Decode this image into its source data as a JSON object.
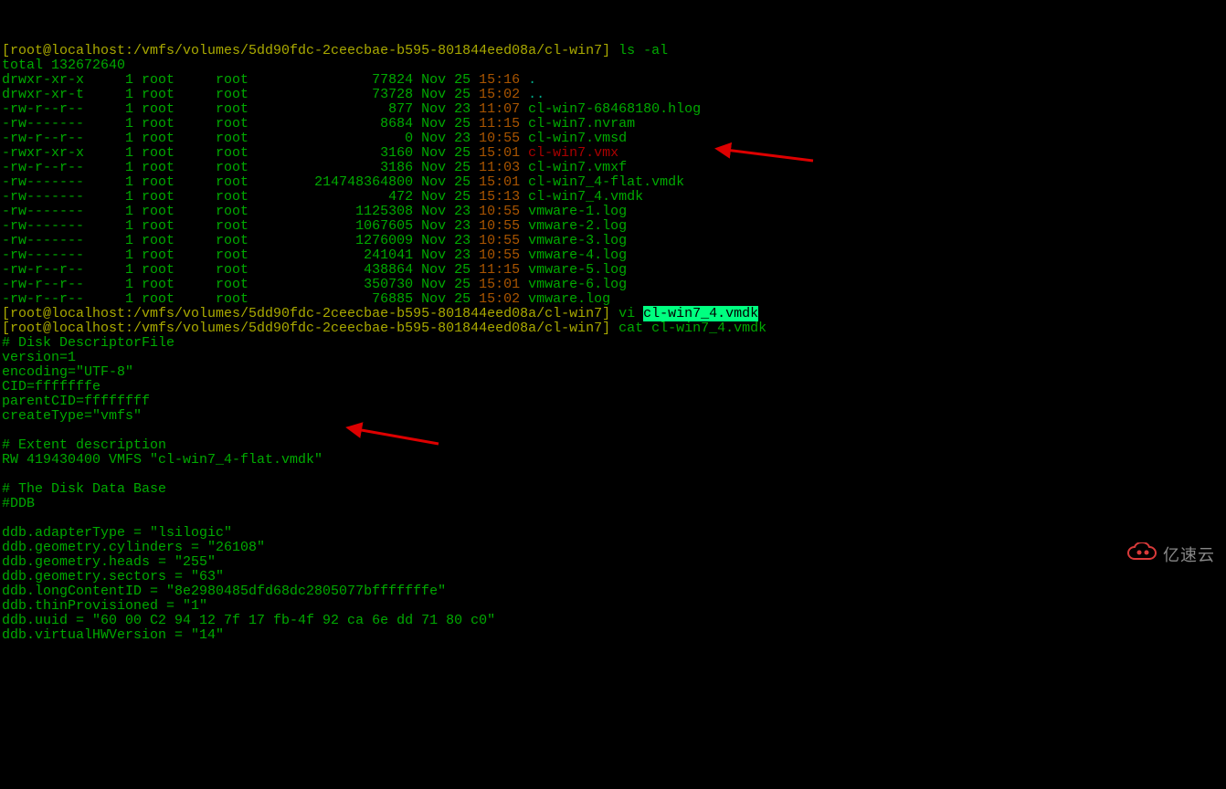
{
  "prompt_path": "[root@localhost:/vmfs/volumes/5dd90fdc-2ceecbae-b595-801844eed08a/cl-win7]",
  "cmd_ls": "ls -al",
  "total_line": "total 132672640",
  "listing": [
    {
      "perm": "drwxr-xr-x",
      "links": "1",
      "owner": "root",
      "group": "root",
      "size": "77824",
      "month": "Nov",
      "day": "25",
      "time": "15:16",
      "name": ".",
      "name_class": "cyan"
    },
    {
      "perm": "drwxr-xr-t",
      "links": "1",
      "owner": "root",
      "group": "root",
      "size": "73728",
      "month": "Nov",
      "day": "25",
      "time": "15:02",
      "name": "..",
      "name_class": "cyan"
    },
    {
      "perm": "-rw-r--r--",
      "links": "1",
      "owner": "root",
      "group": "root",
      "size": "877",
      "month": "Nov",
      "day": "23",
      "time": "11:07",
      "name": "cl-win7-68468180.hlog",
      "name_class": "green"
    },
    {
      "perm": "-rw-------",
      "links": "1",
      "owner": "root",
      "group": "root",
      "size": "8684",
      "month": "Nov",
      "day": "25",
      "time": "11:15",
      "name": "cl-win7.nvram",
      "name_class": "green"
    },
    {
      "perm": "-rw-r--r--",
      "links": "1",
      "owner": "root",
      "group": "root",
      "size": "0",
      "month": "Nov",
      "day": "23",
      "time": "10:55",
      "name": "cl-win7.vmsd",
      "name_class": "green"
    },
    {
      "perm": "-rwxr-xr-x",
      "links": "1",
      "owner": "root",
      "group": "root",
      "size": "3160",
      "month": "Nov",
      "day": "25",
      "time": "15:01",
      "name": "cl-win7.vmx",
      "name_class": "red"
    },
    {
      "perm": "-rw-r--r--",
      "links": "1",
      "owner": "root",
      "group": "root",
      "size": "3186",
      "month": "Nov",
      "day": "25",
      "time": "11:03",
      "name": "cl-win7.vmxf",
      "name_class": "green"
    },
    {
      "perm": "-rw-------",
      "links": "1",
      "owner": "root",
      "group": "root",
      "size": "214748364800",
      "month": "Nov",
      "day": "25",
      "time": "15:01",
      "name": "cl-win7_4-flat.vmdk",
      "name_class": "green"
    },
    {
      "perm": "-rw-------",
      "links": "1",
      "owner": "root",
      "group": "root",
      "size": "472",
      "month": "Nov",
      "day": "25",
      "time": "15:13",
      "name": "cl-win7_4.vmdk",
      "name_class": "green"
    },
    {
      "perm": "-rw-------",
      "links": "1",
      "owner": "root",
      "group": "root",
      "size": "1125308",
      "month": "Nov",
      "day": "23",
      "time": "10:55",
      "name": "vmware-1.log",
      "name_class": "green"
    },
    {
      "perm": "-rw-------",
      "links": "1",
      "owner": "root",
      "group": "root",
      "size": "1067605",
      "month": "Nov",
      "day": "23",
      "time": "10:55",
      "name": "vmware-2.log",
      "name_class": "green"
    },
    {
      "perm": "-rw-------",
      "links": "1",
      "owner": "root",
      "group": "root",
      "size": "1276009",
      "month": "Nov",
      "day": "23",
      "time": "10:55",
      "name": "vmware-3.log",
      "name_class": "green"
    },
    {
      "perm": "-rw-------",
      "links": "1",
      "owner": "root",
      "group": "root",
      "size": "241041",
      "month": "Nov",
      "day": "23",
      "time": "10:55",
      "name": "vmware-4.log",
      "name_class": "green"
    },
    {
      "perm": "-rw-r--r--",
      "links": "1",
      "owner": "root",
      "group": "root",
      "size": "438864",
      "month": "Nov",
      "day": "25",
      "time": "11:15",
      "name": "vmware-5.log",
      "name_class": "green"
    },
    {
      "perm": "-rw-r--r--",
      "links": "1",
      "owner": "root",
      "group": "root",
      "size": "350730",
      "month": "Nov",
      "day": "25",
      "time": "15:01",
      "name": "vmware-6.log",
      "name_class": "green"
    },
    {
      "perm": "-rw-r--r--",
      "links": "1",
      "owner": "root",
      "group": "root",
      "size": "76885",
      "month": "Nov",
      "day": "25",
      "time": "15:02",
      "name": "vmware.log",
      "name_class": "green"
    }
  ],
  "cmd_vi": "vi ",
  "vi_arg": "cl-win7_4.vmdk",
  "cmd_cat": "cat cl-win7_4.vmdk",
  "descriptor": [
    "# Disk DescriptorFile",
    "version=1",
    "encoding=\"UTF-8\"",
    "CID=fffffffe",
    "parentCID=ffffffff",
    "createType=\"vmfs\"",
    "",
    "# Extent description",
    "RW 419430400 VMFS \"cl-win7_4-flat.vmdk\"",
    "",
    "# The Disk Data Base",
    "#DDB",
    "",
    "ddb.adapterType = \"lsilogic\"",
    "ddb.geometry.cylinders = \"26108\"",
    "ddb.geometry.heads = \"255\"",
    "ddb.geometry.sectors = \"63\"",
    "ddb.longContentID = \"8e2980485dfd68dc2805077bfffffffe\"",
    "ddb.thinProvisioned = \"1\"",
    "ddb.uuid = \"60 00 C2 94 12 7f 17 fb-4f 92 ca 6e dd 71 80 c0\"",
    "ddb.virtualHWVersion = \"14\""
  ],
  "watermark_text": "亿速云"
}
